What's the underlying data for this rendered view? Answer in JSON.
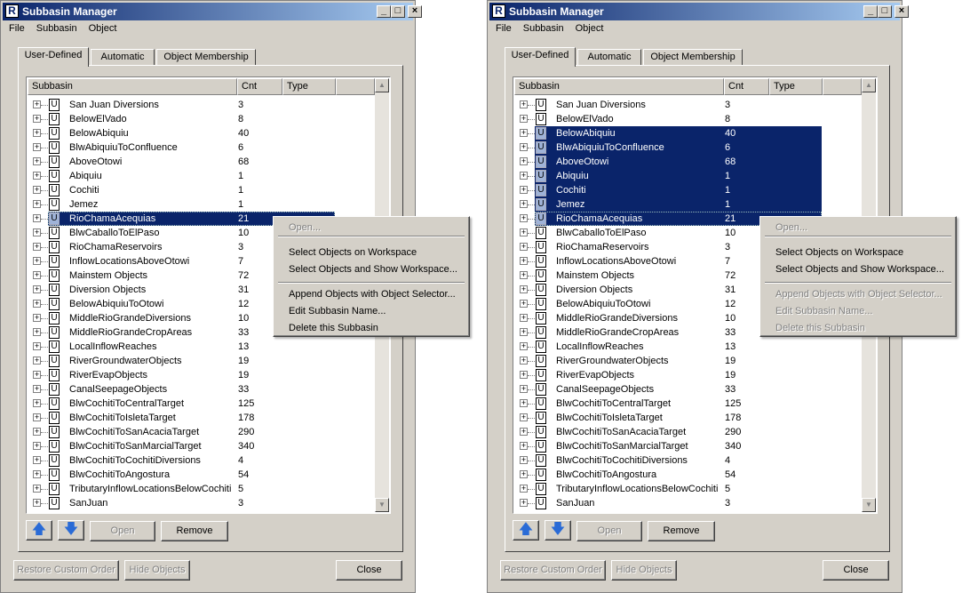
{
  "windows": [
    {
      "title": "Subbasin Manager",
      "menu": [
        "File",
        "Subbasin",
        "Object"
      ],
      "tabs": [
        "User-Defined",
        "Automatic",
        "Object Membership"
      ],
      "columns": [
        "Subbasin",
        "Cnt",
        "Type"
      ],
      "rows": [
        {
          "name": "San Juan Diversions",
          "cnt": "3"
        },
        {
          "name": "BelowElVado",
          "cnt": "8"
        },
        {
          "name": "BelowAbiquiu",
          "cnt": "40"
        },
        {
          "name": "BlwAbiquiuToConfluence",
          "cnt": "6"
        },
        {
          "name": "AboveOtowi",
          "cnt": "68"
        },
        {
          "name": "Abiquiu",
          "cnt": "1"
        },
        {
          "name": "Cochiti",
          "cnt": "1"
        },
        {
          "name": "Jemez",
          "cnt": "1"
        },
        {
          "name": "RioChamaAcequias",
          "cnt": "21"
        },
        {
          "name": "BlwCaballoToElPaso",
          "cnt": "10"
        },
        {
          "name": "RioChamaReservoirs",
          "cnt": "3"
        },
        {
          "name": "InflowLocationsAboveOtowi",
          "cnt": "7"
        },
        {
          "name": "Mainstem Objects",
          "cnt": "72"
        },
        {
          "name": "Diversion Objects",
          "cnt": "31"
        },
        {
          "name": "BelowAbiquiuToOtowi",
          "cnt": "12"
        },
        {
          "name": "MiddleRioGrandeDiversions",
          "cnt": "10"
        },
        {
          "name": "MiddleRioGrandeCropAreas",
          "cnt": "33"
        },
        {
          "name": "LocalInflowReaches",
          "cnt": "13"
        },
        {
          "name": "RiverGroundwaterObjects",
          "cnt": "19"
        },
        {
          "name": "RiverEvapObjects",
          "cnt": "19"
        },
        {
          "name": "CanalSeepageObjects",
          "cnt": "33"
        },
        {
          "name": "BlwCochitiToCentralTarget",
          "cnt": "125"
        },
        {
          "name": "BlwCochitiToIsletaTarget",
          "cnt": "178"
        },
        {
          "name": "BlwCochitiToSanAcaciaTarget",
          "cnt": "290"
        },
        {
          "name": "BlwCochitiToSanMarcialTarget",
          "cnt": "340"
        },
        {
          "name": "BlwCochitiToCochitiDiversions",
          "cnt": "4"
        },
        {
          "name": "BlwCochitiToAngostura",
          "cnt": "54"
        },
        {
          "name": "TributaryInflowLocationsBelowCochiti",
          "cnt": "5"
        },
        {
          "name": "SanJuan",
          "cnt": "3"
        }
      ],
      "selected_rows": [
        8
      ],
      "focused_row": 8,
      "buttons": {
        "up": "up-arrow-icon",
        "down": "down-arrow-icon",
        "open": "Open",
        "remove": "Remove",
        "restore": "Restore Custom Order",
        "hide": "Hide Objects",
        "close": "Close"
      },
      "context_menu": {
        "items": [
          {
            "label": "Open...",
            "enabled": false
          },
          {
            "sep": true
          },
          {
            "label": "Select Objects on Workspace",
            "enabled": true
          },
          {
            "label": "Select Objects and Show Workspace...",
            "enabled": true
          },
          {
            "sep": true
          },
          {
            "label": "Append Objects with Object Selector...",
            "enabled": true
          },
          {
            "label": "Edit Subbasin Name...",
            "enabled": true
          },
          {
            "label": "Delete this Subbasin",
            "enabled": true
          }
        ]
      }
    },
    {
      "title": "Subbasin Manager",
      "menu": [
        "File",
        "Subbasin",
        "Object"
      ],
      "tabs": [
        "User-Defined",
        "Automatic",
        "Object Membership"
      ],
      "columns": [
        "Subbasin",
        "Cnt",
        "Type"
      ],
      "rows": [
        {
          "name": "San Juan Diversions",
          "cnt": "3"
        },
        {
          "name": "BelowElVado",
          "cnt": "8"
        },
        {
          "name": "BelowAbiquiu",
          "cnt": "40"
        },
        {
          "name": "BlwAbiquiuToConfluence",
          "cnt": "6"
        },
        {
          "name": "AboveOtowi",
          "cnt": "68"
        },
        {
          "name": "Abiquiu",
          "cnt": "1"
        },
        {
          "name": "Cochiti",
          "cnt": "1"
        },
        {
          "name": "Jemez",
          "cnt": "1"
        },
        {
          "name": "RioChamaAcequias",
          "cnt": "21"
        },
        {
          "name": "BlwCaballoToElPaso",
          "cnt": "10"
        },
        {
          "name": "RioChamaReservoirs",
          "cnt": "3"
        },
        {
          "name": "InflowLocationsAboveOtowi",
          "cnt": "7"
        },
        {
          "name": "Mainstem Objects",
          "cnt": "72"
        },
        {
          "name": "Diversion Objects",
          "cnt": "31"
        },
        {
          "name": "BelowAbiquiuToOtowi",
          "cnt": "12"
        },
        {
          "name": "MiddleRioGrandeDiversions",
          "cnt": "10"
        },
        {
          "name": "MiddleRioGrandeCropAreas",
          "cnt": "33"
        },
        {
          "name": "LocalInflowReaches",
          "cnt": "13"
        },
        {
          "name": "RiverGroundwaterObjects",
          "cnt": "19"
        },
        {
          "name": "RiverEvapObjects",
          "cnt": "19"
        },
        {
          "name": "CanalSeepageObjects",
          "cnt": "33"
        },
        {
          "name": "BlwCochitiToCentralTarget",
          "cnt": "125"
        },
        {
          "name": "BlwCochitiToIsletaTarget",
          "cnt": "178"
        },
        {
          "name": "BlwCochitiToSanAcaciaTarget",
          "cnt": "290"
        },
        {
          "name": "BlwCochitiToSanMarcialTarget",
          "cnt": "340"
        },
        {
          "name": "BlwCochitiToCochitiDiversions",
          "cnt": "4"
        },
        {
          "name": "BlwCochitiToAngostura",
          "cnt": "54"
        },
        {
          "name": "TributaryInflowLocationsBelowCochiti",
          "cnt": "5"
        },
        {
          "name": "SanJuan",
          "cnt": "3"
        }
      ],
      "selected_rows": [
        2,
        3,
        4,
        5,
        6,
        7,
        8
      ],
      "focused_row": 8,
      "buttons": {
        "up": "up-arrow-icon",
        "down": "down-arrow-icon",
        "open": "Open",
        "remove": "Remove",
        "restore": "Restore Custom Order",
        "hide": "Hide Objects",
        "close": "Close"
      },
      "context_menu": {
        "items": [
          {
            "label": "Open...",
            "enabled": false
          },
          {
            "sep": true
          },
          {
            "label": "Select Objects on Workspace",
            "enabled": true
          },
          {
            "label": "Select Objects and Show Workspace...",
            "enabled": true
          },
          {
            "sep": true
          },
          {
            "label": "Append Objects with Object Selector...",
            "enabled": false
          },
          {
            "label": "Edit Subbasin Name...",
            "enabled": false
          },
          {
            "label": "Delete this Subbasin",
            "enabled": false
          }
        ]
      }
    }
  ],
  "colors": {
    "selection": "#0a246a",
    "title_start": "#0a246a",
    "title_end": "#a6caf0",
    "face": "#d4d0c8"
  }
}
